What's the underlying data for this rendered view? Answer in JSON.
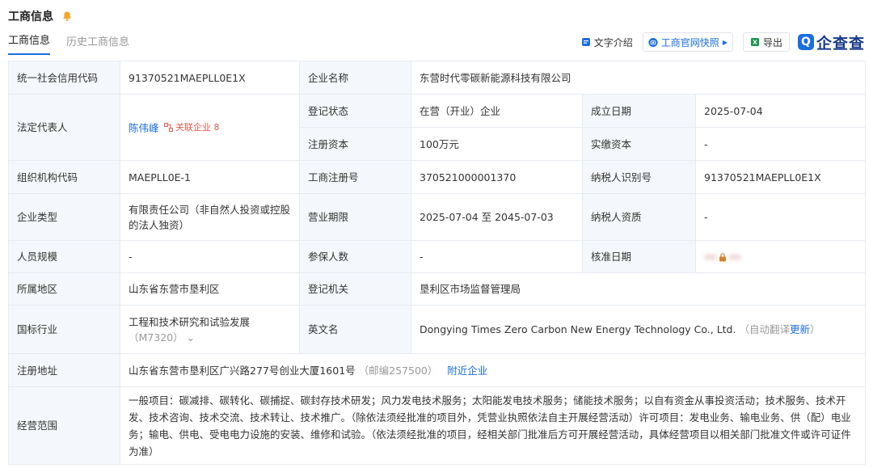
{
  "header": {
    "title": "工商信息"
  },
  "tabs": [
    {
      "label": "工商信息"
    },
    {
      "label": "历史工商信息"
    }
  ],
  "toolbar": {
    "text_intro": "文字介绍",
    "official_snapshot": "工商官网快照",
    "export": "导出",
    "brand": "企查查"
  },
  "colors": {
    "accent": "#1a6ee1",
    "label_bg": "#f4f7fb",
    "border": "#e6eaf0",
    "badge": "#e85a4f"
  },
  "info": {
    "credit_code_label": "统一社会信用代码",
    "credit_code": "91370521MAEPLL0E1X",
    "company_name_label": "企业名称",
    "company_name": "东营时代零碳新能源科技有限公司",
    "legal_rep_label": "法定代表人",
    "legal_rep": "陈伟峰",
    "related_label": "关联企业",
    "related_count": "8",
    "reg_status_label": "登记状态",
    "reg_status": "在营（开业）企业",
    "found_date_label": "成立日期",
    "found_date": "2025-07-04",
    "reg_capital_label": "注册资本",
    "reg_capital": "100万元",
    "paid_capital_label": "实缴资本",
    "paid_capital": "-",
    "org_code_label": "组织机构代码",
    "org_code": "MAEPLL0E-1",
    "biz_reg_no_label": "工商注册号",
    "biz_reg_no": "370521000001370",
    "taxpayer_id_label": "纳税人识别号",
    "taxpayer_id": "91370521MAEPLL0E1X",
    "company_type_label": "企业类型",
    "company_type": "有限责任公司（非自然人投资或控股的法人独资）",
    "biz_term_label": "营业期限",
    "biz_term": "2025-07-04 至 2045-07-03",
    "taxpayer_qual_label": "纳税人资质",
    "taxpayer_qual": "-",
    "staff_size_label": "人员规模",
    "staff_size": "-",
    "insured_label": "参保人数",
    "insured": "-",
    "approval_date_label": "核准日期",
    "region_label": "所属地区",
    "region": "山东省东营市垦利区",
    "reg_authority_label": "登记机关",
    "reg_authority": "垦利区市场监督管理局",
    "industry_label": "国标行业",
    "industry": "工程和技术研究和试验发展",
    "industry_code": "（M7320）",
    "english_name_label": "英文名",
    "english_name": "Dongying Times Zero Carbon New Energy Technology Co., Ltd.",
    "auto_translate": "（自动翻译",
    "update": "更新",
    "auto_translate_end": "）",
    "address_label": "注册地址",
    "address": "山东省东营市垦利区广兴路277号创业大厦1601号",
    "postcode": "（邮编257500）",
    "nearby": "附近企业",
    "scope_label": "经营范围",
    "scope": "一般项目：碳减排、碳转化、碳捕捉、碳封存技术研发；风力发电技术服务；太阳能发电技术服务；储能技术服务；以自有资金从事投资活动；技术服务、技术开发、技术咨询、技术交流、技术转让、技术推广。（除依法须经批准的项目外，凭营业执照依法自主开展经营活动）许可项目：发电业务、输电业务、供（配）电业务；输电、供电、受电电力设施的安装、维修和试验。（依法须经批准的项目，经相关部门批准后方可开展经营活动，具体经营项目以相关部门批准文件或许可证件为准）"
  }
}
